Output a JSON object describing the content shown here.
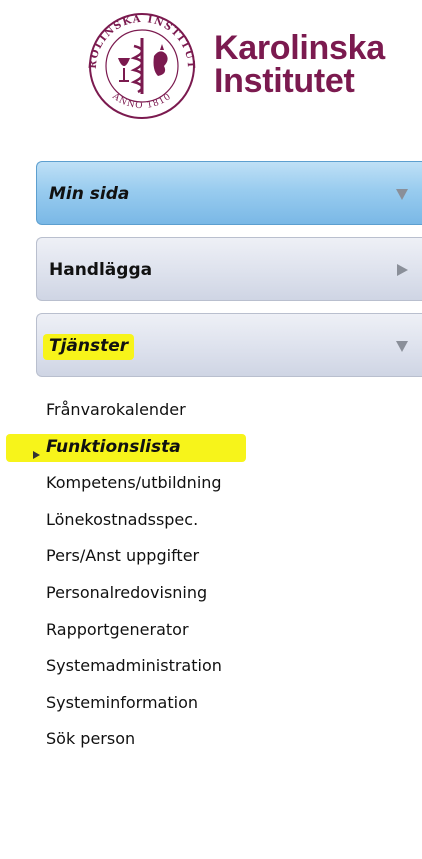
{
  "logo": {
    "name_line1": "Karolinska",
    "name_line2": "Institutet",
    "seal_text_top": "KAROLINSKA INSTITUTET",
    "seal_text_bottom": "ANNO 1810",
    "brand_color": "#7b1a4f"
  },
  "menu": {
    "panels": [
      {
        "label": "Min sida",
        "state": "expanded",
        "arrow": "chevron-down-icon"
      },
      {
        "label": "Handlägga",
        "state": "collapsed",
        "arrow": "chevron-right-icon"
      },
      {
        "label": "Tjänster",
        "state": "expanded",
        "arrow": "chevron-down-icon",
        "highlighted": true
      }
    ],
    "items": [
      {
        "label": "Frånvarokalender"
      },
      {
        "label": "Funktionslista",
        "current": true,
        "highlighted": true
      },
      {
        "label": "Kompetens/utbildning"
      },
      {
        "label": "Lönekostnadsspec."
      },
      {
        "label": "Pers/Anst uppgifter"
      },
      {
        "label": "Personalredovisning"
      },
      {
        "label": "Rapportgenerator"
      },
      {
        "label": "Systemadministration"
      },
      {
        "label": "Systeminformation"
      },
      {
        "label": "Sök person"
      }
    ]
  },
  "colors": {
    "active_panel": "#99ccef",
    "inactive_panel": "#dfe3ee",
    "highlight": "#f7f41a"
  }
}
